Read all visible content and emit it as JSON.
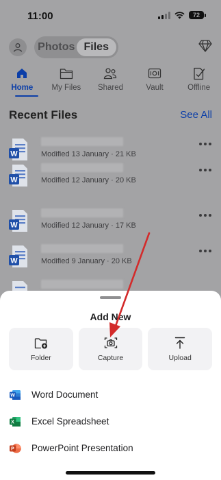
{
  "status_bar": {
    "time": "11:00",
    "battery": "72"
  },
  "top_bar": {
    "segments": [
      "Photos",
      "Files"
    ],
    "active_segment": "Files"
  },
  "tabs": [
    {
      "label": "Home",
      "icon": "home-icon",
      "active": true
    },
    {
      "label": "My Files",
      "icon": "folder-icon",
      "active": false
    },
    {
      "label": "Shared",
      "icon": "people-icon",
      "active": false
    },
    {
      "label": "Vault",
      "icon": "vault-icon",
      "active": false
    },
    {
      "label": "Offline",
      "icon": "offline-icon",
      "active": false
    }
  ],
  "recent": {
    "title": "Recent Files",
    "see_all": "See All",
    "files": [
      {
        "meta": "Modified 13 January · 21 KB"
      },
      {
        "meta": "Modified 12 January · 20 KB"
      },
      {
        "meta": "Modified 12 January · 17 KB"
      },
      {
        "meta": "Modified 9 January · 20 KB"
      }
    ]
  },
  "sheet": {
    "title": "Add New",
    "actions": [
      {
        "label": "Folder",
        "icon": "folder-add-icon"
      },
      {
        "label": "Capture",
        "icon": "camera-icon"
      },
      {
        "label": "Upload",
        "icon": "upload-icon"
      }
    ],
    "items": [
      {
        "label": "Word Document",
        "icon": "word-icon"
      },
      {
        "label": "Excel Spreadsheet",
        "icon": "excel-icon"
      },
      {
        "label": "PowerPoint Presentation",
        "icon": "powerpoint-icon"
      }
    ]
  },
  "colors": {
    "accent": "#0b3ea8",
    "annotation_arrow": "#d32b2b",
    "word": "#185abd",
    "excel": "#107c41",
    "powerpoint": "#c43e1c"
  }
}
